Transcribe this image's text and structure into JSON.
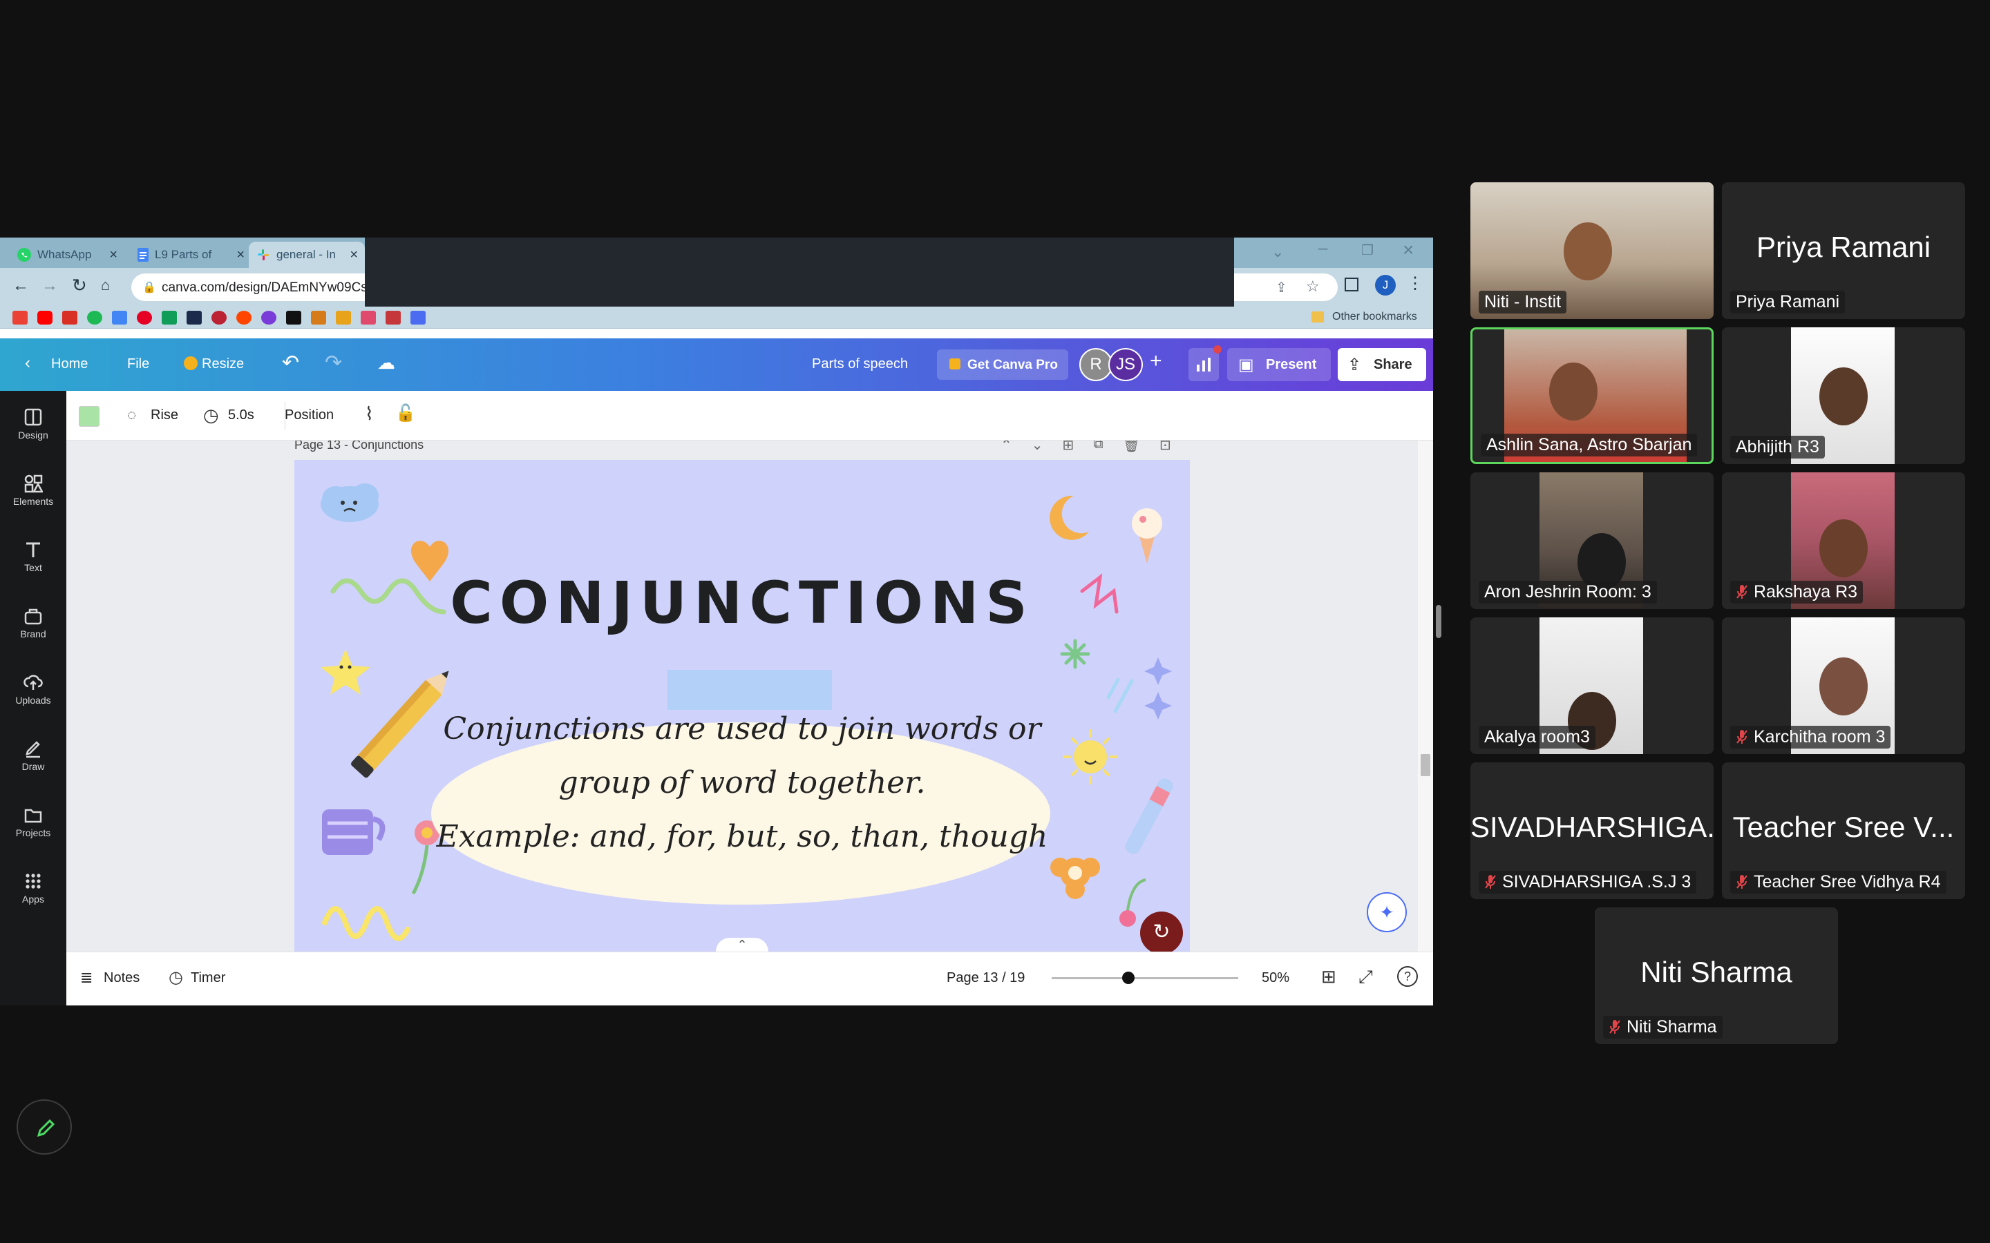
{
  "browser": {
    "tabs": [
      {
        "label": "WhatsApp"
      },
      {
        "label": "L9 Parts of"
      },
      {
        "label": "general - In"
      }
    ],
    "url": "canva.com/design/DAEmNYw09Cs/",
    "bookmarks_other": "Other bookmarks",
    "profile_initial": "J"
  },
  "canva": {
    "home": "Home",
    "file": "File",
    "resize": "Resize",
    "title": "Parts of speech",
    "get_pro": "Get Canva Pro",
    "avatar_r": "R",
    "avatar_js": "JS",
    "present": "Present",
    "share": "Share",
    "toolbar": {
      "animation": "Rise",
      "duration": "5.0s",
      "position": "Position",
      "accent_color": "#a9e3a5"
    },
    "sidebar": [
      {
        "label": "Design",
        "icon": "design-icon"
      },
      {
        "label": "Elements",
        "icon": "elements-icon"
      },
      {
        "label": "Text",
        "icon": "text-icon"
      },
      {
        "label": "Brand",
        "icon": "brand-icon"
      },
      {
        "label": "Uploads",
        "icon": "uploads-icon"
      },
      {
        "label": "Draw",
        "icon": "draw-icon"
      },
      {
        "label": "Projects",
        "icon": "projects-icon"
      },
      {
        "label": "Apps",
        "icon": "apps-icon"
      }
    ],
    "page_label": "Page 13 - Conjunctions",
    "slide": {
      "title": "CONJUNCTIONS",
      "line1": "Conjunctions are used to join words or",
      "line2": "group of word together.",
      "line3": "Example: and, for, but, so, than, though",
      "bg_color": "#cfd2fb",
      "bubble_color": "#fdf7e6"
    },
    "bottom": {
      "notes": "Notes",
      "timer": "Timer",
      "page": "Page 13 / 19",
      "zoom_value": 50,
      "zoom": "50%"
    }
  },
  "participants": [
    {
      "name": "Niti - Instit",
      "video": true,
      "muted": false,
      "active": false
    },
    {
      "name": "Priya Ramani",
      "big": "Priya Ramani",
      "video": false,
      "muted": false,
      "active": false
    },
    {
      "name": "Ashlin Sana, Astro Sbarjan",
      "video": true,
      "muted": false,
      "active": true
    },
    {
      "name": "Abhijith R3",
      "video": true,
      "muted": false,
      "active": false
    },
    {
      "name": "Aron Jeshrin  Room: 3",
      "video": true,
      "muted": false,
      "active": false
    },
    {
      "name": "Rakshaya R3",
      "video": true,
      "muted": true,
      "active": false
    },
    {
      "name": "Akalya room3",
      "video": true,
      "muted": false,
      "active": false
    },
    {
      "name": "Karchitha room  3",
      "video": true,
      "muted": true,
      "active": false
    },
    {
      "name": "SIVADHARSHIGA .S.J 3",
      "big": "SIVADHARSHIGA...",
      "video": false,
      "muted": true,
      "active": false
    },
    {
      "name": "Teacher Sree Vidhya R4",
      "big": "Teacher Sree V...",
      "video": false,
      "muted": true,
      "active": false
    },
    {
      "name": "Niti Sharma",
      "big": "Niti Sharma",
      "video": false,
      "muted": true,
      "active": false
    }
  ],
  "colors": {
    "background": "#111111",
    "tile": "#262626",
    "active_border": "#5cd65c",
    "mute_red": "#e0454a"
  }
}
